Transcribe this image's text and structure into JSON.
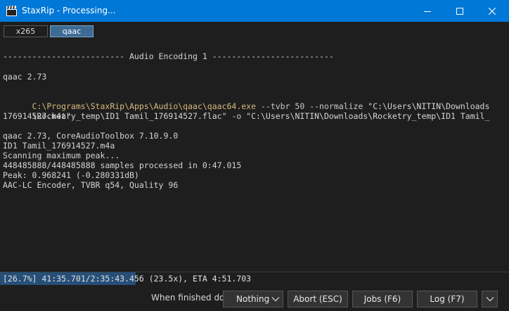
{
  "window": {
    "title": "StaxRip - Processing...",
    "icons": {
      "app": "clapperboard-icon",
      "minimize": "minimize-icon",
      "maximize": "maximize-icon",
      "close": "close-icon"
    }
  },
  "tabs": [
    {
      "label": "x265",
      "selected": false
    },
    {
      "label": "qaac",
      "selected": true
    }
  ],
  "log": {
    "header": "------------------------- Audio Encoding 1 -------------------------",
    "version_line": "qaac 2.73",
    "command": {
      "line1": {
        "path": "C:\\Programs\\StaxRip\\Apps\\Audio\\qaac\\qaac64.exe",
        "args": " --tvbr 50 --normalize ",
        "str": "\"C:\\Users\\NITIN\\Downloads"
      },
      "line2": {
        "str1": "\\Rocketry_temp\\ID1 Tamil_176914527.flac\"",
        "args": " -o ",
        "str2": "\"C:\\Users\\NITIN\\Downloads\\Rocketry_temp\\ID1 Tamil_"
      },
      "line3": "176914527.m4a\""
    },
    "output": [
      "qaac 2.73, CoreAudioToolbox 7.10.9.0",
      "ID1 Tamil_176914527.m4a",
      "Scanning maximum peak...",
      "448485888/448485888 samples processed in 0:47.015",
      "Peak: 0.968241 (-0.280331dB)",
      "AAC-LC Encoder, TVBR q54, Quality 96"
    ]
  },
  "progress": {
    "text": "[26.7%] 41:35.701/2:35:43.456 (23.5x), ETA 4:51.703",
    "percent": 26.7,
    "fill_color": "#264f78"
  },
  "footer": {
    "when_finished_label": "When finished do:",
    "when_finished_value": "Nothing",
    "abort_label": "Abort (ESC)",
    "jobs_label": "Jobs (F6)",
    "log_label": "Log (F7)",
    "menu_icon": "chevron-down-icon"
  },
  "colors": {
    "titlebar": "#0078d7",
    "background": "#1e1e1e",
    "exe_path": "#d7ba7d",
    "selected_tab": "#3d6b94"
  }
}
